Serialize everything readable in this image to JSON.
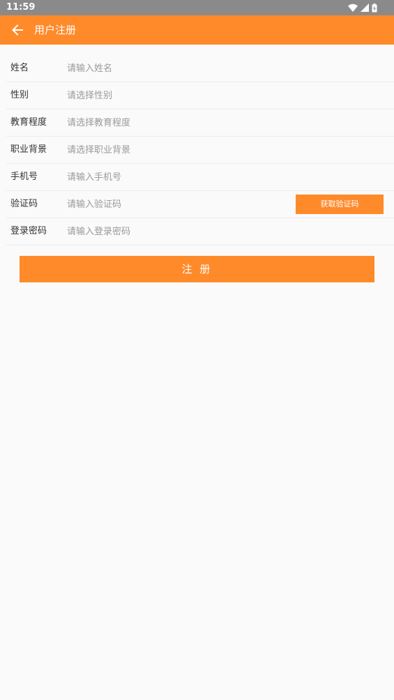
{
  "status_bar": {
    "time": "11:59",
    "icons": [
      "wifi-icon",
      "cell-signal-icon",
      "battery-charging-icon"
    ]
  },
  "app_bar": {
    "back_icon": "arrow-left-icon",
    "title": "用户注册"
  },
  "form": {
    "rows": [
      {
        "label": "姓名",
        "placeholder": "请输入姓名",
        "value": ""
      },
      {
        "label": "性别",
        "placeholder": "请选择性别",
        "value": ""
      },
      {
        "label": "教育程度",
        "placeholder": "请选择教育程度",
        "value": ""
      },
      {
        "label": "职业背景",
        "placeholder": "请选择职业背景",
        "value": ""
      },
      {
        "label": "手机号",
        "placeholder": "请输入手机号",
        "value": ""
      },
      {
        "label": "验证码",
        "placeholder": "请输入验证码",
        "value": ""
      },
      {
        "label": "登录密码",
        "placeholder": "请输入登录密码",
        "value": ""
      }
    ],
    "get_code_label": "获取验证码"
  },
  "register_label": "注 册",
  "colors": {
    "accent": "#ff8a2a",
    "status_bar": "#8a8a8a",
    "background": "#fafafa",
    "divider": "#ececec",
    "label_text": "#333333",
    "placeholder_text": "#9a9a9a"
  }
}
